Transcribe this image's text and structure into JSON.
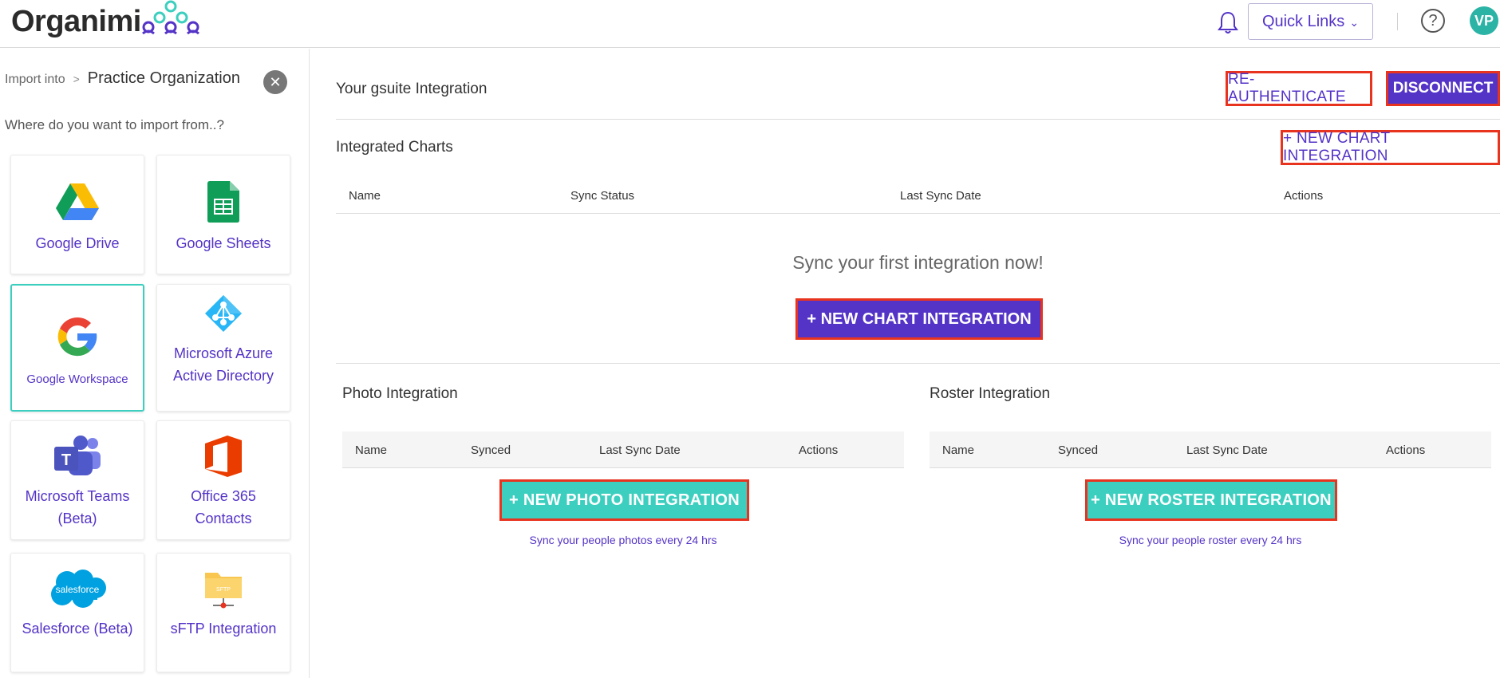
{
  "header": {
    "logo_text": "Organimi",
    "quick_links_label": "Quick Links",
    "quick_links_chevron": "⌄",
    "help_glyph": "?",
    "avatar_initials": "VP"
  },
  "sidebar": {
    "import_into_label": "Import into",
    "breadcrumb_sep": ">",
    "organization_name": "Practice Organization",
    "close_glyph": "✕",
    "prompt": "Where do you want to import from..?",
    "sources": [
      {
        "label": "Google Drive",
        "icon": "google-drive-icon"
      },
      {
        "label": "Google Sheets",
        "icon": "google-sheets-icon"
      },
      {
        "label": "Google Workspace",
        "icon": "google-icon"
      },
      {
        "label": "Microsoft Azure Active Directory",
        "icon": "azure-ad-icon"
      },
      {
        "label": "Microsoft Teams (Beta)",
        "icon": "microsoft-teams-icon"
      },
      {
        "label": "Office 365 Contacts",
        "icon": "office-365-icon"
      },
      {
        "label": "Salesforce (Beta)",
        "icon": "salesforce-icon"
      },
      {
        "label": "sFTP Integration",
        "icon": "sftp-folder-icon"
      }
    ],
    "salesforce_logo_text": "salesforce",
    "sftp_icon_text": "SFTP"
  },
  "main": {
    "integration_title": "Your gsuite Integration",
    "reauth_label": "RE-AUTHENTICATE",
    "disconnect_label": "DISCONNECT",
    "charts": {
      "title": "Integrated Charts",
      "new_button_label": "+ NEW CHART INTEGRATION",
      "columns": [
        "Name",
        "Sync Status",
        "Last Sync Date",
        "Actions"
      ],
      "empty_message": "Sync your first integration now!",
      "center_button_label": "+ NEW CHART INTEGRATION"
    },
    "photo": {
      "title": "Photo Integration",
      "columns": [
        "Name",
        "Synced",
        "Last Sync Date",
        "Actions"
      ],
      "button_label": "+ NEW PHOTO INTEGRATION",
      "hint": "Sync your people photos every 24 hrs"
    },
    "roster": {
      "title": "Roster Integration",
      "columns": [
        "Name",
        "Synced",
        "Last Sync Date",
        "Actions"
      ],
      "button_label": "+ NEW ROSTER INTEGRATION",
      "hint": "Sync your people roster every 24 hrs"
    }
  },
  "colors": {
    "brand_purple": "#5433c7",
    "teal": "#3ccfbf",
    "highlight_red": "#e8341f"
  }
}
